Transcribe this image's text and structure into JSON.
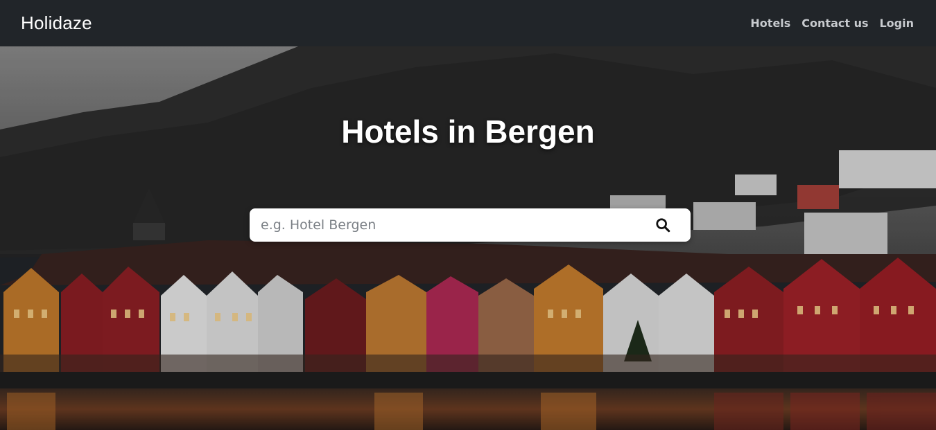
{
  "navbar": {
    "brand": "Holidaze",
    "links": [
      {
        "label": "Hotels"
      },
      {
        "label": "Contact us"
      },
      {
        "label": "Login"
      }
    ]
  },
  "hero": {
    "title": "Hotels in Bergen",
    "background": "bergen-bryggen-waterfront-photo"
  },
  "search": {
    "placeholder": "e.g. Hotel Bergen",
    "value": "",
    "icon": "search-icon"
  },
  "colors": {
    "navbar_bg": "#212529",
    "nav_link": "#c8cbcf",
    "brand": "#ffffff"
  }
}
